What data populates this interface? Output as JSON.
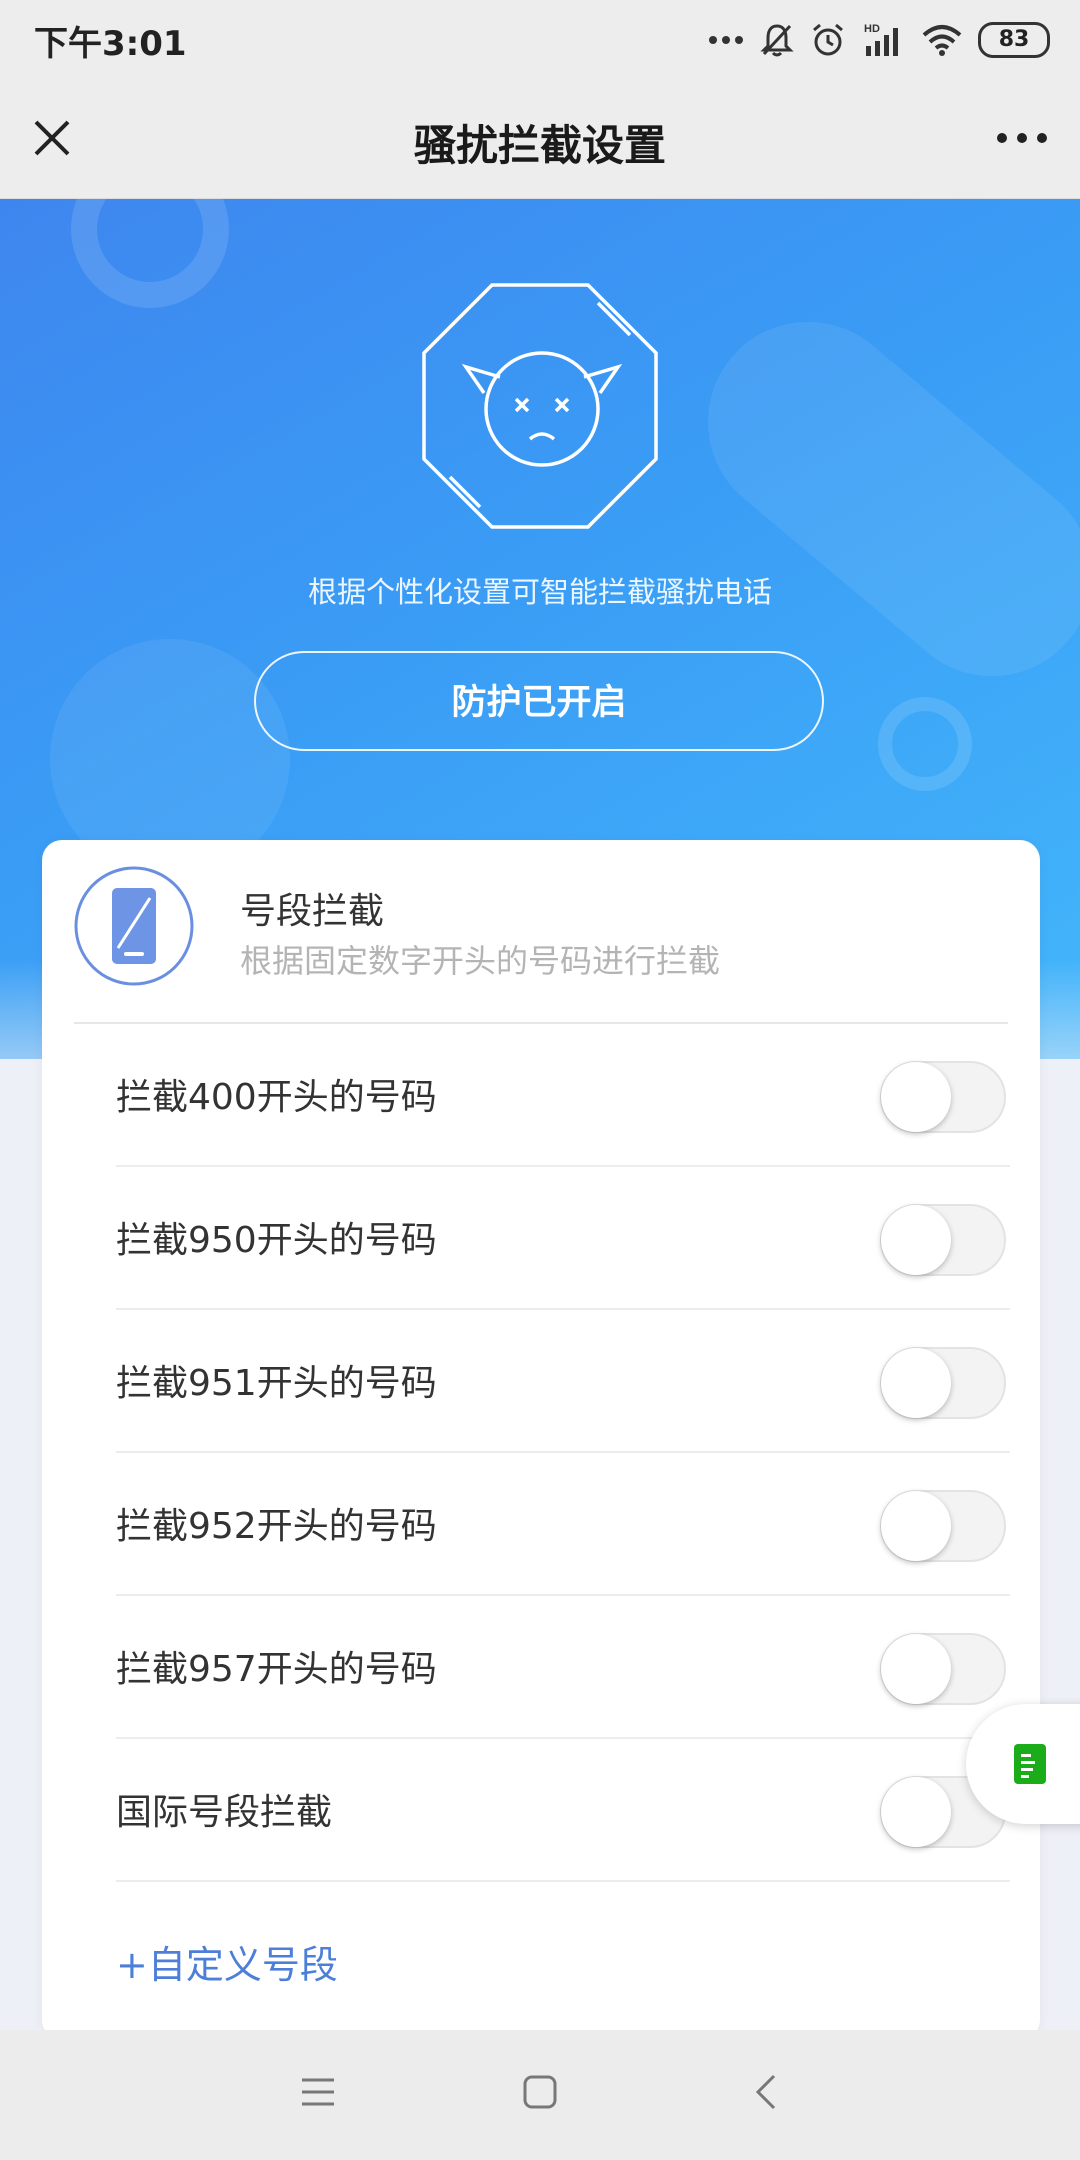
{
  "status_bar": {
    "time": "下午3:01",
    "battery": "83",
    "network_label": "HD",
    "icons": [
      "more-dots-icon",
      "mute-bell-icon",
      "alarm-icon",
      "signal-icon",
      "wifi-icon",
      "battery-icon"
    ]
  },
  "nav": {
    "title": "骚扰拦截设置",
    "close_icon": "close-icon",
    "more_icon": "more-icon"
  },
  "hero": {
    "icon": "angry-devil-shield-icon",
    "description": "根据个性化设置可智能拦截骚扰电话",
    "protect_button": "防护已开启"
  },
  "card": {
    "icon": "phone-icon",
    "title": "号段拦截",
    "subtitle": "根据固定数字开头的号码进行拦截",
    "rows": [
      {
        "label": "拦截400开头的号码",
        "enabled": false
      },
      {
        "label": "拦截950开头的号码",
        "enabled": false
      },
      {
        "label": "拦截951开头的号码",
        "enabled": false
      },
      {
        "label": "拦截952开头的号码",
        "enabled": false
      },
      {
        "label": "拦截957开头的号码",
        "enabled": false
      },
      {
        "label": "国际号段拦截",
        "enabled": false
      }
    ],
    "custom_link": "+自定义号段"
  },
  "floating_button": {
    "icon": "document-icon",
    "color": "#1aad19"
  },
  "bottom_nav": {
    "icons": [
      "menu-icon",
      "home-icon",
      "back-icon"
    ]
  },
  "colors": {
    "accent_blue": "#3a9cf5",
    "link": "#4d7fd8"
  }
}
